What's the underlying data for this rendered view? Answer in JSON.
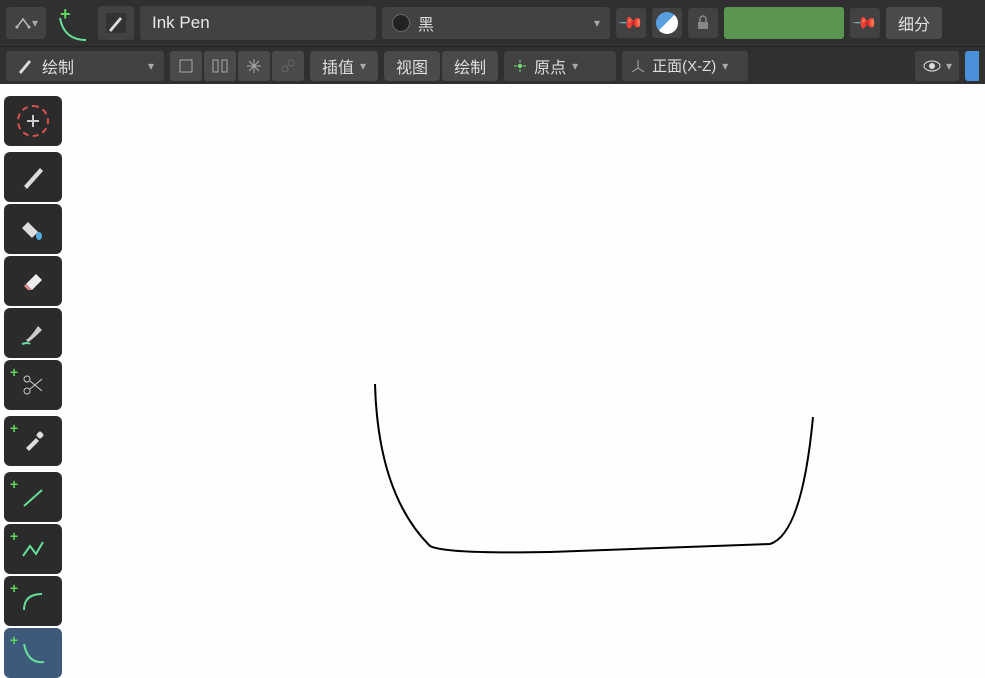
{
  "header": {
    "brush_name": "Ink Pen",
    "color_label": "黑",
    "subdivide_label": "细分"
  },
  "toolbar": {
    "mode_label": "绘制",
    "interpolate_label": "插值",
    "view_label": "视图",
    "draw_label": "绘制",
    "origin_label": "原点",
    "align_label": "正面(X-Z)"
  },
  "tools": {
    "cursor": "cursor-3d",
    "draw": "draw",
    "fill": "fill",
    "erase": "erase",
    "tint": "tint",
    "cutter": "cutter",
    "eyedropper": "eyedropper",
    "line": "line",
    "polyline": "polyline",
    "arc": "arc",
    "curve": "curve"
  }
}
